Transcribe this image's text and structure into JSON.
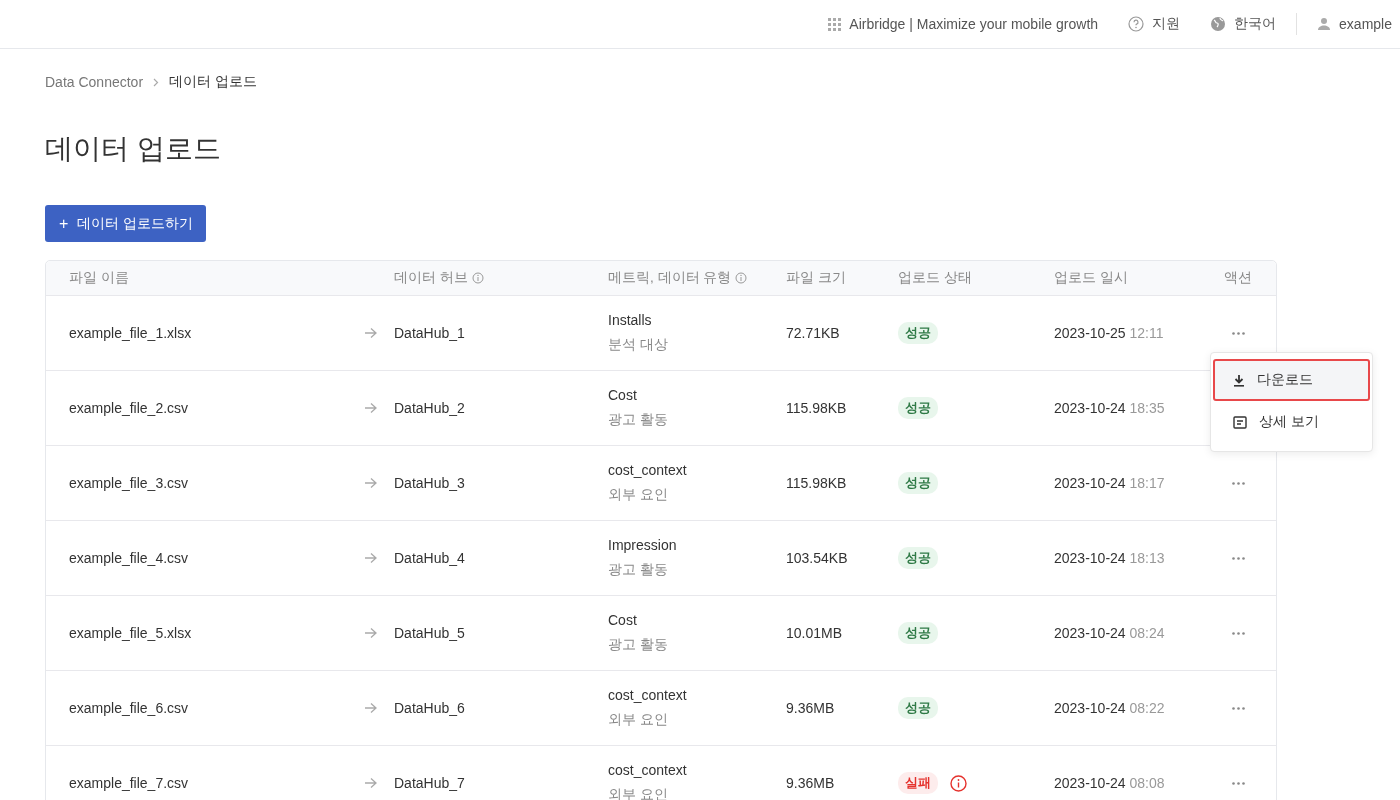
{
  "topbar": {
    "product": "Airbridge | Maximize your mobile growth",
    "support": "지원",
    "language": "한국어",
    "user": "example"
  },
  "breadcrumb": [
    "Data Connector",
    "데이터 업로드"
  ],
  "title": "데이터 업로드",
  "upload_button": {
    "icon": "+",
    "label": "데이터 업로드하기"
  },
  "table": {
    "columns": [
      {
        "kind": "plain",
        "label": "파일 이름"
      },
      {
        "kind": "with-info",
        "label": "데이터 허브"
      },
      {
        "kind": "with-info",
        "label": "메트릭, 데이터 유형"
      },
      {
        "kind": "plain",
        "label": "파일 크기"
      },
      {
        "kind": "plain",
        "label": "업로드 상태"
      },
      {
        "kind": "plain",
        "label": "업로드 일시"
      },
      {
        "kind": "plain",
        "label": "액션"
      }
    ],
    "rows": [
      {
        "file": "example_file_1.xlsx",
        "hub": "DataHub_1",
        "metric": "Installs",
        "type": "분석 대상",
        "size": "72.71KB",
        "status": {
          "kind": "success",
          "label": "성공"
        },
        "date": "2023-10-25",
        "time": "12:11"
      },
      {
        "file": "example_file_2.csv",
        "hub": "DataHub_2",
        "metric": "Cost",
        "type": "광고 활동",
        "size": "115.98KB",
        "status": {
          "kind": "success",
          "label": "성공"
        },
        "date": "2023-10-24",
        "time": "18:35"
      },
      {
        "file": "example_file_3.csv",
        "hub": "DataHub_3",
        "metric": "cost_context",
        "type": "외부 요인",
        "size": "115.98KB",
        "status": {
          "kind": "success",
          "label": "성공"
        },
        "date": "2023-10-24",
        "time": "18:17"
      },
      {
        "file": "example_file_4.csv",
        "hub": "DataHub_4",
        "metric": "Impression",
        "type": "광고 활동",
        "size": "103.54KB",
        "status": {
          "kind": "success",
          "label": "성공"
        },
        "date": "2023-10-24",
        "time": "18:13"
      },
      {
        "file": "example_file_5.xlsx",
        "hub": "DataHub_5",
        "metric": "Cost",
        "type": "광고 활동",
        "size": "10.01MB",
        "status": {
          "kind": "success",
          "label": "성공"
        },
        "date": "2023-10-24",
        "time": "08:24"
      },
      {
        "file": "example_file_6.csv",
        "hub": "DataHub_6",
        "metric": "cost_context",
        "type": "외부 요인",
        "size": "9.36MB",
        "status": {
          "kind": "success",
          "label": "성공"
        },
        "date": "2023-10-24",
        "time": "08:22"
      },
      {
        "file": "example_file_7.csv",
        "hub": "DataHub_7",
        "metric": "cost_context",
        "type": "외부 요인",
        "size": "9.36MB",
        "status": {
          "kind": "fail",
          "label": "실패"
        },
        "date": "2023-10-24",
        "time": "08:08"
      }
    ]
  },
  "menu": {
    "items": [
      {
        "kind": "download",
        "label": "다운로드",
        "selected": true
      },
      {
        "kind": "details",
        "label": "상세 보기",
        "selected": false
      }
    ]
  }
}
